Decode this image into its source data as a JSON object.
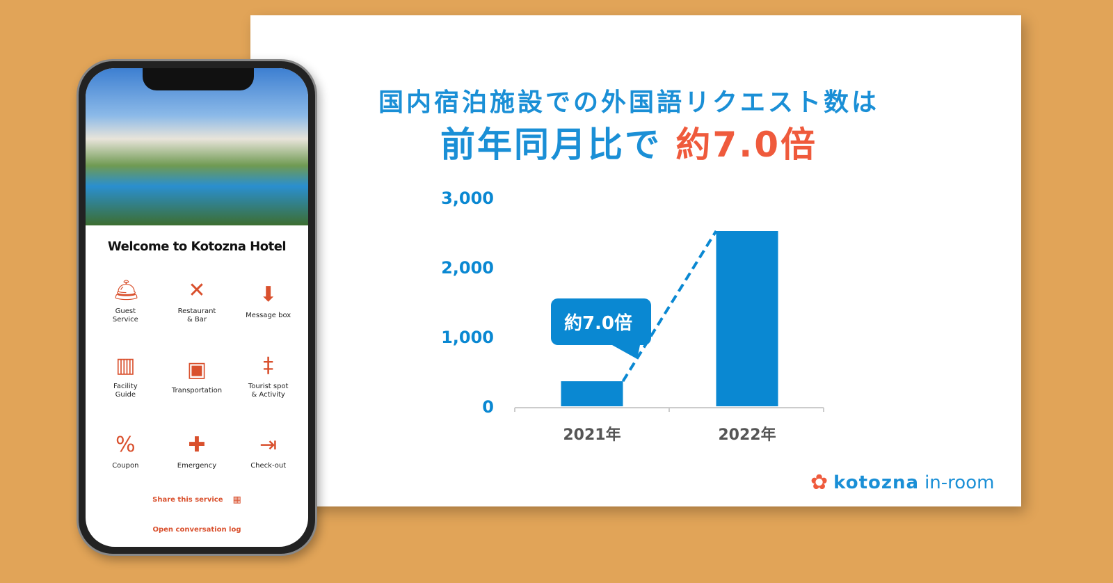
{
  "headline": {
    "line1": "国内宿泊施設での外国語リクエスト数は",
    "line2_prefix": "前年同月比で ",
    "line2_highlight": "約7.0倍"
  },
  "colors": {
    "background": "#e1a458",
    "accent_blue": "#0a88d2",
    "highlight_red": "#ef5a3c",
    "app_orange": "#d9502d"
  },
  "chart_data": {
    "type": "bar",
    "categories": [
      "2021年",
      "2022年"
    ],
    "values": [
      360,
      2520
    ],
    "ylim": [
      0,
      3000
    ],
    "yticks": [
      "0",
      "1,000",
      "2,000",
      "3,000"
    ],
    "ytick_values": [
      0,
      1000,
      2000,
      3000
    ],
    "annotation": "約7.0倍",
    "grid": false,
    "xlabel": "",
    "ylabel": ""
  },
  "logo": {
    "brand": "kotozna",
    "product": "in-room"
  },
  "phone": {
    "welcome": "Welcome to Kotozna Hotel",
    "items": [
      {
        "label": "Guest\nService",
        "icon": "bell-desk-icon"
      },
      {
        "label": "Restaurant\n& Bar",
        "icon": "fork-knife-icon"
      },
      {
        "label": "Message box",
        "icon": "inbox-icon"
      },
      {
        "label": "Facility\nGuide",
        "icon": "building-info-icon"
      },
      {
        "label": "Transportation",
        "icon": "taxi-icon"
      },
      {
        "label": "Tourist spot\n& Activity",
        "icon": "signpost-icon"
      },
      {
        "label": "Coupon",
        "icon": "coupon-icon"
      },
      {
        "label": "Emergency",
        "icon": "siren-icon"
      },
      {
        "label": "Check-out",
        "icon": "exit-door-icon"
      }
    ],
    "share": "Share this service",
    "open_log": "Open conversation log"
  }
}
